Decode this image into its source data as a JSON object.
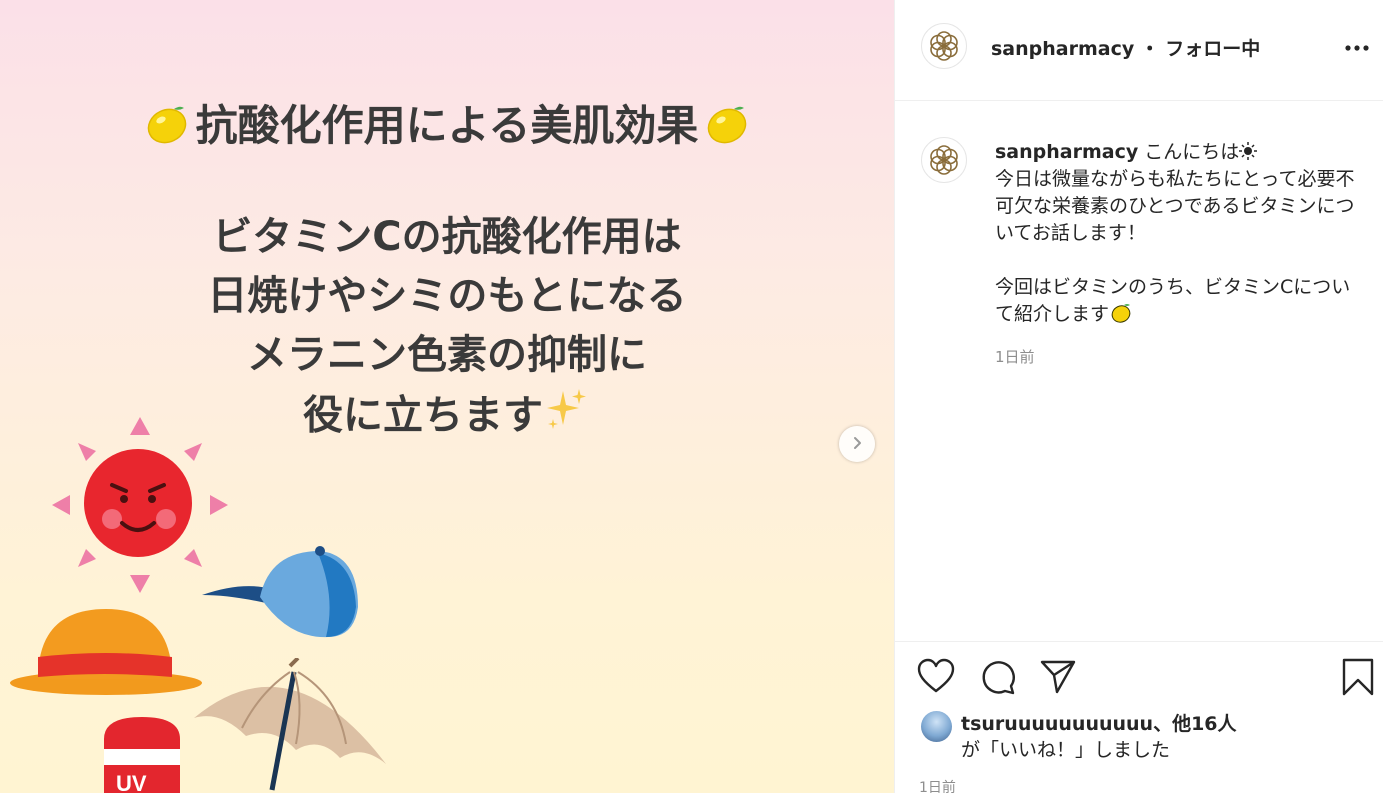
{
  "post": {
    "image": {
      "headline": "抗酸化作用による美肌効果",
      "body_lines": [
        "ビタミンCの抗酸化作用は",
        "日焼けやシミのもとになる",
        "メラニン色素の抑制に",
        "役に立ちます"
      ],
      "sunscreen_label": "UV"
    }
  },
  "header": {
    "username": "sanpharmacy",
    "separator": "・",
    "follow_status": "フォロー中"
  },
  "caption": {
    "username": "sanpharmacy",
    "greeting": "こんにちは",
    "paragraph1": "今日は微量ながらも私たちにとって必要不可欠な栄養素のひとつであるビタミンについてお話します！",
    "paragraph2": "今回はビタミンのうち、ビタミンCについて紹介します",
    "time": "1日前"
  },
  "likes": {
    "user": "tsuruuuuuuuuuuu",
    "others": "、他16人",
    "suffix": "が「いいね！」しました"
  },
  "footer": {
    "time": "1日前"
  },
  "icons": {
    "like": "heart-icon",
    "comment": "comment-icon",
    "share": "paper-plane-icon",
    "save": "bookmark-icon",
    "more": "more-options-icon",
    "next": "chevron-right-icon"
  }
}
